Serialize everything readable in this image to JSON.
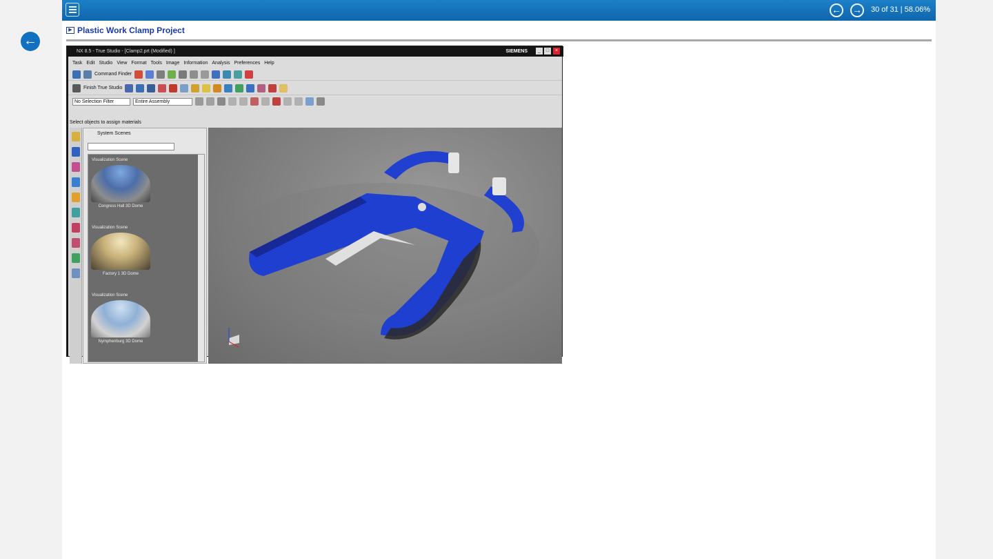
{
  "header": {
    "page_count": "30 of 31 | 58.06%",
    "menu_icon": "list-menu-icon",
    "prev_icon": "arrow-left-circle-icon",
    "next_icon": "arrow-right-circle-icon"
  },
  "back_icon": "arrow-left-circle-icon",
  "slide": {
    "title": "Plastic Work Clamp Project"
  },
  "app": {
    "window_title": "NX 8.5 - True Studio - [Clamp2.prt (Modified) ]",
    "brand": "SIEMENS",
    "menus": [
      "Task",
      "Edit",
      "Studio",
      "View",
      "Format",
      "Tools",
      "Image",
      "Information",
      "Analysis",
      "Preferences",
      "Help"
    ],
    "command_finder": "Command Finder",
    "finish_studio": "Finish True Studio",
    "selection_filter": "No Selection Filter",
    "assembly_scope": "Entire Assembly",
    "status": "Select objects to assign materials",
    "panel_title": "System Scenes",
    "scenes": [
      {
        "category": "Visualization Scene",
        "name": "Congress Hall 3D Dome"
      },
      {
        "category": "Visualization Scene",
        "name": "Factory 1 3D Dome"
      },
      {
        "category": "Visualization Scene",
        "name": "Nymphenburg 3D Dome"
      }
    ]
  },
  "colors": {
    "header_blue": "#1270c0",
    "title_blue": "#1a3aa8",
    "clamp_blue": "#1f3fd1"
  }
}
